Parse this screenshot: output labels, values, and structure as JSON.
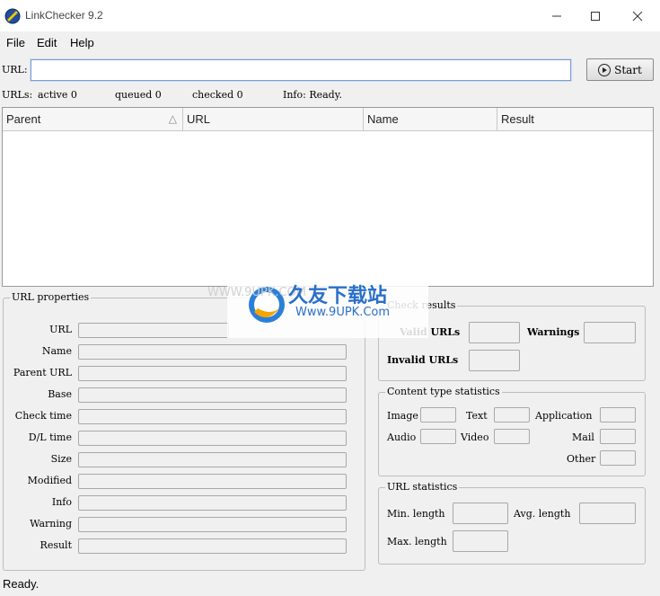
{
  "window": {
    "title": "LinkChecker 9.2",
    "minimize_icon": "minimize-icon",
    "maximize_icon": "maximize-icon",
    "close_icon": "close-icon"
  },
  "menu": {
    "file": "File",
    "edit": "Edit",
    "help": "Help"
  },
  "url_bar": {
    "label": "URL:",
    "value": "",
    "start_label": "Start"
  },
  "status": {
    "urls_label": "URLs:",
    "active": "active 0",
    "queued": "queued 0",
    "checked": "checked 0",
    "info": "Info: Ready."
  },
  "table": {
    "columns": [
      "Parent",
      "URL",
      "Name",
      "Result"
    ],
    "sort_indicator": "△"
  },
  "url_properties": {
    "title": "URL properties",
    "fields": [
      "URL",
      "Name",
      "Parent URL",
      "Base",
      "Check time",
      "D/L time",
      "Size",
      "Modified",
      "Info",
      "Warning",
      "Result"
    ]
  },
  "check_results": {
    "title": "Check results",
    "valid_urls": "Valid URLs",
    "warnings": "Warnings",
    "invalid_urls": "Invalid URLs"
  },
  "content_stats": {
    "title": "Content type statistics",
    "image": "Image",
    "text": "Text",
    "application": "Application",
    "audio": "Audio",
    "video": "Video",
    "mail": "Mail",
    "other": "Other"
  },
  "url_stats": {
    "title": "URL statistics",
    "min_length": "Min. length",
    "avg_length": "Avg. length",
    "max_length": "Max. length"
  },
  "watermark": {
    "brand": "久友下载站",
    "url": "Www.9UPK.Com",
    "faint": "WWW.9UPK.COM"
  },
  "statusbar": {
    "text": "Ready."
  },
  "colors": {
    "focus_border": "#7a9cd3",
    "group_border": "#bdbdbd",
    "bg": "#f0f0f0"
  }
}
